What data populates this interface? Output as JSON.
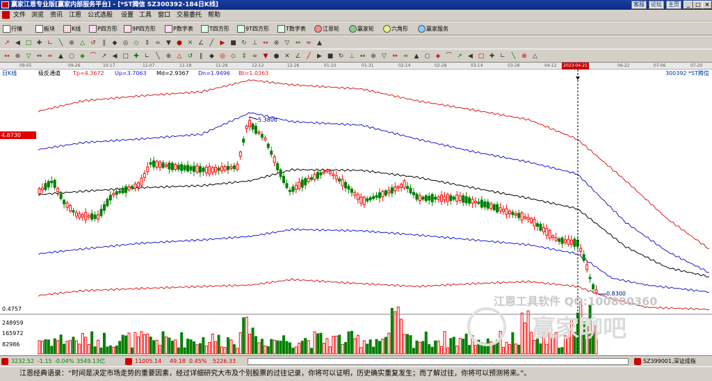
{
  "window": {
    "title": "赢家江恩专业版[赢家内部服务平台] - [*ST腾信  SZ300392-184日K线]",
    "links": [
      "客服",
      "论坛",
      "主页"
    ]
  },
  "menu": [
    "文件",
    "浏览",
    "资讯",
    "江恩",
    "公式选股",
    "设置",
    "工具",
    "窗口",
    "交易委托",
    "帮助"
  ],
  "toolbar1": [
    "行情",
    "板块",
    "K线",
    "P四方形",
    "9P四方形",
    "P数字表",
    "T四方形",
    "9T四方形",
    "T数字表",
    "江恩轮",
    "赢家轮",
    "六角形",
    "赢家服务"
  ],
  "timeaxis": {
    "dates": [
      "09-05",
      "09-26",
      "10-17",
      "11-07",
      "11-18",
      "11-28",
      "12-12",
      "12-26",
      "01-10",
      "01-31",
      "02-14",
      "02-28",
      "03-14",
      "03-28",
      "04-12",
      "06-22",
      "07-06",
      "07-20"
    ],
    "selected": "2023-04-21"
  },
  "chart": {
    "period_label": "日K线",
    "indicator": "极反通道",
    "values": {
      "tp": "Tp=4.3672",
      "up": "Up=3.7063",
      "md": "Md=2.9367",
      "dn": "Dn=1.9496",
      "bt": "Bt=1.0363"
    },
    "stock": "300392 *ST腾信",
    "price_tag": "4.8730",
    "high_label": "5.3800",
    "low_label": "0.8300",
    "vol_min": "0.4757",
    "vol_ticks": [
      "248959",
      "165972",
      "82986"
    ],
    "watermark_1": "江恩工具软件  QQ:100800360",
    "watermark_2": "赢家聊吧",
    "colors": {
      "up": "#ff0000",
      "down": "#008000",
      "tp": "#d81b1b",
      "up_band": "#1a1acc",
      "mid": "#000000"
    }
  },
  "status": {
    "sh": "3232.52",
    "sh_chg": "-1.15",
    "sh_pct": "-0.04%",
    "sh_amt": "3549.13亿",
    "sz": "11005.14",
    "sz_chg": "49.18",
    "sz_pct": "0.45%",
    "sz_amt": "5226.33",
    "right": "SZ399001,深证成指"
  },
  "quote": {
    "label": "江恩经典语录：",
    "text": "“时间是决定市场走势的重要因素，经过详细研究大市及个别股票的过往记录，你将可以证明，历史确实重复发生；而了解过往，你将可以预测将来。”。"
  }
}
